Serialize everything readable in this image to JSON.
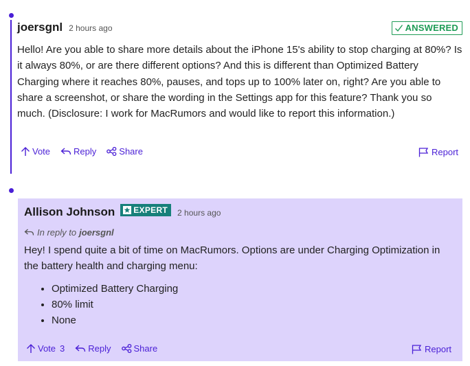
{
  "question": {
    "author": "joersgnl",
    "time": "2 hours ago",
    "status_badge": "ANSWERED",
    "body": "Hello! Are you able to share more details about the iPhone 15's ability to stop charging at 80%? Is it always 80%, or are there different options? And this is different than Optimized Battery Charging where it reaches 80%, pauses, and tops up to 100% later on, right? Are you able to share a screenshot, or share the wording in the Settings app for this feature? Thank you so much. (Disclosure: I work for MacRumors and would like to report this information.)",
    "actions": {
      "vote_label": "Vote",
      "reply_label": "Reply",
      "share_label": "Share",
      "report_label": "Report"
    }
  },
  "answer": {
    "author": "Allison Johnson",
    "badge": "EXPERT",
    "time": "2 hours ago",
    "in_reply_prefix": "In reply to",
    "in_reply_user": "joersgnl",
    "body": "Hey! I spend quite a bit of time on MacRumors. Options are under Charging Optimization in the battery health and charging menu:",
    "options": [
      "Optimized Battery Charging",
      "80% limit",
      "None"
    ],
    "actions": {
      "vote_label": "Vote",
      "vote_count": "3",
      "reply_label": "Reply",
      "share_label": "Share",
      "report_label": "Report"
    }
  },
  "colors": {
    "accent": "#4a1fd6",
    "answered_green": "#1d9b55",
    "expert_teal": "#17807a",
    "answer_bg": "#ddd3fc"
  },
  "icons": [
    "arrow-up-icon",
    "reply-arrow-icon",
    "share-icon",
    "flag-icon",
    "check-icon",
    "star-icon"
  ]
}
